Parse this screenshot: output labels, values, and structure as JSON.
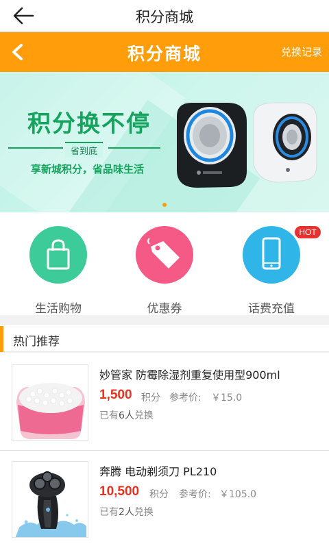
{
  "nav": {
    "title": "积分商城",
    "back_icon": "arrow-left-icon"
  },
  "header": {
    "title": "积分商城",
    "record_label": "兑换记录",
    "back_icon": "chevron-left-icon",
    "color": "#ff9d0a"
  },
  "banner": {
    "headline": "积分换不停",
    "badge": "省到底",
    "slogan": "享新城积分，省品味生活",
    "active_page": 1,
    "page_count": 1
  },
  "categories": [
    {
      "label": "生活购物",
      "icon": "shopping-bag-icon",
      "color": "#3dcb9a"
    },
    {
      "label": "优惠券",
      "icon": "coupon-tag-icon",
      "color": "#f55a86"
    },
    {
      "label": "话费充值",
      "icon": "mobile-phone-icon",
      "color": "#2fb5e8",
      "badge": "HOT"
    }
  ],
  "hot": {
    "title": "热门推荐",
    "products": [
      {
        "name": "妙管家 防霉除湿剂重复使用型900ml",
        "points": "1,500",
        "points_unit": "积分",
        "ref_label": "参考价:",
        "ref_price": "￥15.0",
        "ex_prefix": "已有",
        "ex_count": "6人",
        "ex_suffix": "兑换"
      },
      {
        "name": "奔腾 电动剃须刀 PL210",
        "points": "10,500",
        "points_unit": "积分",
        "ref_label": "参考价:",
        "ref_price": "￥105.0",
        "ex_prefix": "已有",
        "ex_count": "2人",
        "ex_suffix": "兑换"
      }
    ]
  }
}
